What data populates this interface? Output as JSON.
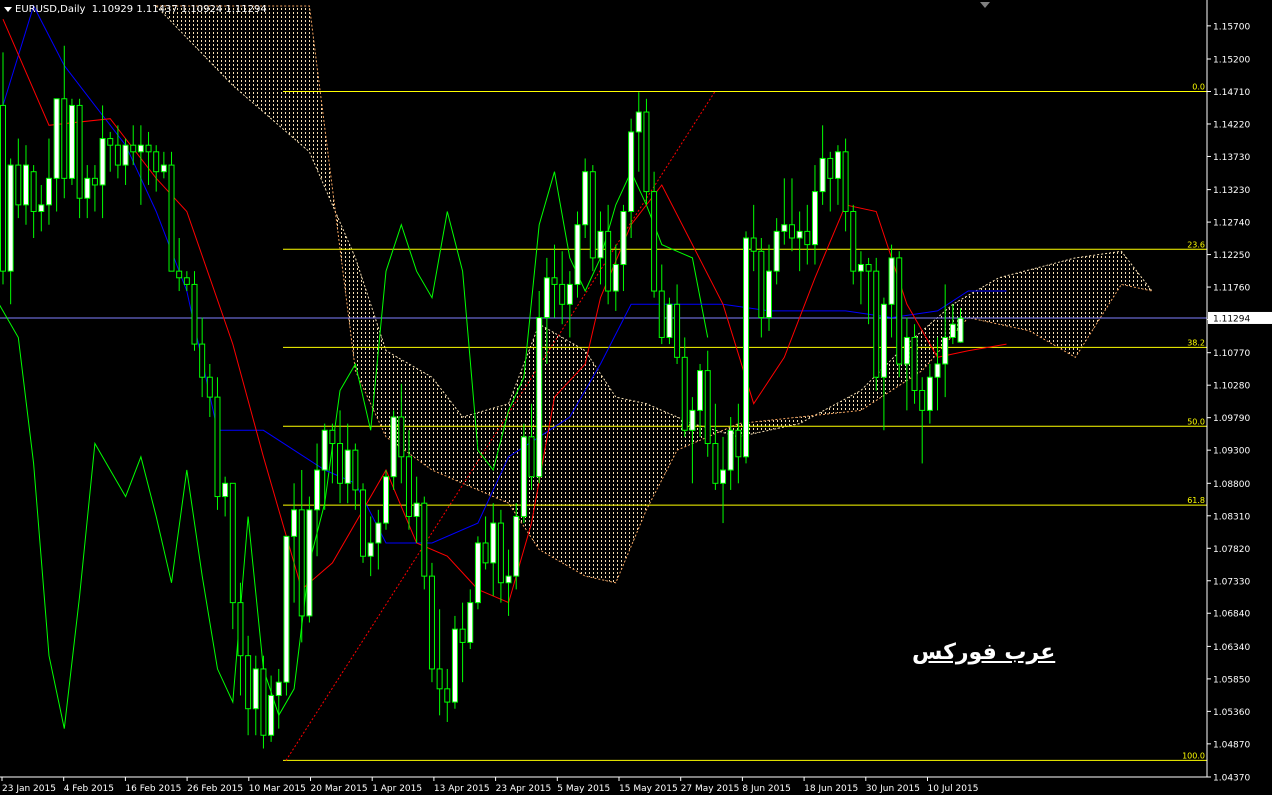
{
  "symbol": {
    "name": "EURUSD,Daily",
    "ohlc": "1.10929 1.11437 1.10924 1.11294"
  },
  "watermark": "عرب فوركس",
  "colors": {
    "background": "#000000",
    "bull": "#00ff00",
    "bear": "#00ff00",
    "bull_body": "#ffffff",
    "tenkan": "#ff0000",
    "kijun": "#0000ff",
    "chikou": "#00ff00",
    "kumo_up": "#f5deb3",
    "kumo_down": "#f4a460",
    "fib": "#ffff00",
    "trend": "#ff0000",
    "price_line": "#7f7fff",
    "axis": "#ffffff"
  },
  "chart_data": {
    "type": "candlestick",
    "title": "EURUSD,Daily",
    "ylim": [
      1.0437,
      1.1609
    ],
    "yticks": [
      "1.15700",
      "1.15200",
      "1.14710",
      "1.14220",
      "1.13730",
      "1.13230",
      "1.12740",
      "1.12250",
      "1.11760",
      "1.11270",
      "1.10770",
      "1.10280",
      "1.09790",
      "1.09300",
      "1.08800",
      "1.08310",
      "1.07820",
      "1.07330",
      "1.06840",
      "1.06340",
      "1.05850",
      "1.05360",
      "1.04870",
      "1.04370"
    ],
    "xticks": [
      "23 Jan 2015",
      "4 Feb 2015",
      "16 Feb 2015",
      "26 Feb 2015",
      "10 Mar 2015",
      "20 Mar 2015",
      "1 Apr 2015",
      "13 Apr 2015",
      "23 Apr 2015",
      "5 May 2015",
      "15 May 2015",
      "27 May 2015",
      "8 Jun 2015",
      "18 Jun 2015",
      "30 Jun 2015",
      "10 Jul 2015"
    ],
    "current_price": "1.11294",
    "fibonacci": [
      {
        "label": "0.0",
        "price": 1.1471
      },
      {
        "label": "23.6",
        "price": 1.1233
      },
      {
        "label": "38.2",
        "price": 1.1085
      },
      {
        "label": "50.0",
        "price": 1.0966
      },
      {
        "label": "61.8",
        "price": 1.0847
      },
      {
        "label": "100.0",
        "price": 1.0462
      }
    ],
    "candles": [
      [
        1.145,
        1.153,
        1.118,
        1.12
      ],
      [
        1.12,
        1.137,
        1.115,
        1.136
      ],
      [
        1.136,
        1.14,
        1.128,
        1.13
      ],
      [
        1.13,
        1.139,
        1.127,
        1.136
      ],
      [
        1.135,
        1.136,
        1.125,
        1.129
      ],
      [
        1.129,
        1.133,
        1.126,
        1.13
      ],
      [
        1.13,
        1.14,
        1.127,
        1.134
      ],
      [
        1.134,
        1.144,
        1.129,
        1.146
      ],
      [
        1.146,
        1.154,
        1.131,
        1.134
      ],
      [
        1.134,
        1.146,
        1.133,
        1.145
      ],
      [
        1.145,
        1.146,
        1.128,
        1.131
      ],
      [
        1.131,
        1.136,
        1.128,
        1.134
      ],
      [
        1.134,
        1.136,
        1.129,
        1.133
      ],
      [
        1.133,
        1.145,
        1.128,
        1.14
      ],
      [
        1.14,
        1.141,
        1.135,
        1.139
      ],
      [
        1.139,
        1.142,
        1.134,
        1.136
      ],
      [
        1.136,
        1.14,
        1.133,
        1.139
      ],
      [
        1.139,
        1.142,
        1.136,
        1.138
      ],
      [
        1.138,
        1.142,
        1.13,
        1.139
      ],
      [
        1.139,
        1.141,
        1.133,
        1.138
      ],
      [
        1.138,
        1.139,
        1.132,
        1.135
      ],
      [
        1.135,
        1.138,
        1.134,
        1.136
      ],
      [
        1.136,
        1.138,
        1.12,
        1.12
      ],
      [
        1.12,
        1.125,
        1.117,
        1.119
      ],
      [
        1.119,
        1.12,
        1.117,
        1.118
      ],
      [
        1.118,
        1.12,
        1.108,
        1.109
      ],
      [
        1.109,
        1.113,
        1.101,
        1.104
      ],
      [
        1.104,
        1.106,
        1.098,
        1.101
      ],
      [
        1.101,
        1.104,
        1.084,
        1.086
      ],
      [
        1.086,
        1.089,
        1.083,
        1.088
      ],
      [
        1.088,
        1.088,
        1.066,
        1.07
      ],
      [
        1.07,
        1.073,
        1.056,
        1.062
      ],
      [
        1.062,
        1.065,
        1.05,
        1.054
      ],
      [
        1.054,
        1.062,
        1.05,
        1.06
      ],
      [
        1.06,
        1.062,
        1.048,
        1.05
      ],
      [
        1.05,
        1.059,
        1.049,
        1.056
      ],
      [
        1.056,
        1.06,
        1.051,
        1.058
      ],
      [
        1.058,
        1.08,
        1.056,
        1.08
      ],
      [
        1.08,
        1.088,
        1.07,
        1.084
      ],
      [
        1.084,
        1.09,
        1.064,
        1.068
      ],
      [
        1.068,
        1.086,
        1.067,
        1.084
      ],
      [
        1.084,
        1.094,
        1.077,
        1.09
      ],
      [
        1.09,
        1.097,
        1.084,
        1.096
      ],
      [
        1.096,
        1.097,
        1.088,
        1.094
      ],
      [
        1.094,
        1.099,
        1.085,
        1.088
      ],
      [
        1.088,
        1.097,
        1.085,
        1.093
      ],
      [
        1.093,
        1.094,
        1.084,
        1.087
      ],
      [
        1.087,
        1.088,
        1.076,
        1.077
      ],
      [
        1.077,
        1.083,
        1.074,
        1.079
      ],
      [
        1.079,
        1.084,
        1.075,
        1.082
      ],
      [
        1.082,
        1.09,
        1.081,
        1.089
      ],
      [
        1.089,
        1.099,
        1.087,
        1.098
      ],
      [
        1.098,
        1.103,
        1.088,
        1.092
      ],
      [
        1.092,
        1.096,
        1.081,
        1.083
      ],
      [
        1.083,
        1.089,
        1.079,
        1.085
      ],
      [
        1.085,
        1.086,
        1.072,
        1.074
      ],
      [
        1.074,
        1.076,
        1.058,
        1.06
      ],
      [
        1.06,
        1.069,
        1.053,
        1.057
      ],
      [
        1.057,
        1.06,
        1.052,
        1.055
      ],
      [
        1.055,
        1.068,
        1.054,
        1.066
      ],
      [
        1.066,
        1.07,
        1.058,
        1.064
      ],
      [
        1.064,
        1.072,
        1.063,
        1.07
      ],
      [
        1.07,
        1.08,
        1.069,
        1.079
      ],
      [
        1.079,
        1.083,
        1.075,
        1.076
      ],
      [
        1.076,
        1.085,
        1.071,
        1.082
      ],
      [
        1.082,
        1.084,
        1.07,
        1.073
      ],
      [
        1.073,
        1.078,
        1.068,
        1.074
      ],
      [
        1.074,
        1.085,
        1.072,
        1.083
      ],
      [
        1.083,
        1.097,
        1.082,
        1.095
      ],
      [
        1.095,
        1.1,
        1.087,
        1.089
      ],
      [
        1.089,
        1.117,
        1.088,
        1.113
      ],
      [
        1.113,
        1.122,
        1.106,
        1.119
      ],
      [
        1.119,
        1.124,
        1.113,
        1.118
      ],
      [
        1.118,
        1.123,
        1.112,
        1.115
      ],
      [
        1.115,
        1.12,
        1.11,
        1.118
      ],
      [
        1.118,
        1.129,
        1.116,
        1.127
      ],
      [
        1.127,
        1.137,
        1.125,
        1.135
      ],
      [
        1.135,
        1.136,
        1.12,
        1.122
      ],
      [
        1.122,
        1.129,
        1.118,
        1.126
      ],
      [
        1.126,
        1.13,
        1.115,
        1.117
      ],
      [
        1.117,
        1.124,
        1.114,
        1.121
      ],
      [
        1.121,
        1.13,
        1.117,
        1.129
      ],
      [
        1.129,
        1.143,
        1.125,
        1.141
      ],
      [
        1.141,
        1.147,
        1.135,
        1.144
      ],
      [
        1.144,
        1.146,
        1.13,
        1.132
      ],
      [
        1.132,
        1.135,
        1.116,
        1.117
      ],
      [
        1.117,
        1.121,
        1.109,
        1.11
      ],
      [
        1.11,
        1.116,
        1.109,
        1.115
      ],
      [
        1.115,
        1.118,
        1.106,
        1.107
      ],
      [
        1.107,
        1.11,
        1.095,
        1.096
      ],
      [
        1.096,
        1.101,
        1.088,
        1.099
      ],
      [
        1.099,
        1.106,
        1.095,
        1.105
      ],
      [
        1.105,
        1.108,
        1.092,
        1.094
      ],
      [
        1.094,
        1.1,
        1.087,
        1.088
      ],
      [
        1.088,
        1.095,
        1.082,
        1.09
      ],
      [
        1.09,
        1.098,
        1.087,
        1.096
      ],
      [
        1.096,
        1.1,
        1.088,
        1.092
      ],
      [
        1.092,
        1.126,
        1.091,
        1.125
      ],
      [
        1.125,
        1.13,
        1.12,
        1.123
      ],
      [
        1.123,
        1.125,
        1.11,
        1.113
      ],
      [
        1.113,
        1.124,
        1.111,
        1.12
      ],
      [
        1.12,
        1.128,
        1.118,
        1.126
      ],
      [
        1.126,
        1.134,
        1.124,
        1.127
      ],
      [
        1.127,
        1.134,
        1.123,
        1.125
      ],
      [
        1.125,
        1.129,
        1.12,
        1.126
      ],
      [
        1.126,
        1.13,
        1.121,
        1.124
      ],
      [
        1.124,
        1.136,
        1.121,
        1.132
      ],
      [
        1.132,
        1.142,
        1.13,
        1.137
      ],
      [
        1.137,
        1.138,
        1.129,
        1.134
      ],
      [
        1.134,
        1.139,
        1.13,
        1.138
      ],
      [
        1.138,
        1.14,
        1.126,
        1.129
      ],
      [
        1.129,
        1.13,
        1.118,
        1.12
      ],
      [
        1.12,
        1.123,
        1.115,
        1.121
      ],
      [
        1.121,
        1.122,
        1.112,
        1.12
      ],
      [
        1.12,
        1.122,
        1.102,
        1.104
      ],
      [
        1.104,
        1.116,
        1.096,
        1.115
      ],
      [
        1.115,
        1.124,
        1.11,
        1.122
      ],
      [
        1.122,
        1.123,
        1.104,
        1.106
      ],
      [
        1.106,
        1.113,
        1.099,
        1.11
      ],
      [
        1.11,
        1.112,
        1.1,
        1.102
      ],
      [
        1.102,
        1.104,
        1.091,
        1.099
      ],
      [
        1.099,
        1.106,
        1.097,
        1.104
      ],
      [
        1.104,
        1.11,
        1.099,
        1.106
      ],
      [
        1.106,
        1.118,
        1.101,
        1.11
      ],
      [
        1.11,
        1.115,
        1.109,
        1.112
      ],
      [
        1.1093,
        1.1144,
        1.1092,
        1.1129
      ]
    ],
    "tenkan": [
      [
        0,
        1.158
      ],
      [
        6,
        1.142
      ],
      [
        14,
        1.143
      ],
      [
        20,
        1.134
      ],
      [
        24,
        1.129
      ],
      [
        30,
        1.109
      ],
      [
        34,
        1.092
      ],
      [
        39,
        1.072
      ],
      [
        43,
        1.076
      ],
      [
        48,
        1.086
      ],
      [
        50,
        1.09
      ],
      [
        54,
        1.079
      ],
      [
        58,
        1.077
      ],
      [
        62,
        1.072
      ],
      [
        66,
        1.07
      ],
      [
        69,
        1.082
      ],
      [
        72,
        1.101
      ],
      [
        76,
        1.106
      ],
      [
        78,
        1.116
      ],
      [
        82,
        1.127
      ],
      [
        86,
        1.133
      ],
      [
        90,
        1.124
      ],
      [
        94,
        1.115
      ],
      [
        98,
        1.1
      ],
      [
        102,
        1.107
      ],
      [
        106,
        1.119
      ],
      [
        110,
        1.13
      ],
      [
        114,
        1.129
      ],
      [
        118,
        1.115
      ],
      [
        122,
        1.107
      ],
      [
        126,
        1.108
      ],
      [
        131,
        1.109
      ]
    ],
    "kijun": [
      [
        0,
        1.145
      ],
      [
        4,
        1.16
      ],
      [
        8,
        1.151
      ],
      [
        12,
        1.145
      ],
      [
        16,
        1.139
      ],
      [
        20,
        1.129
      ],
      [
        24,
        1.117
      ],
      [
        28,
        1.096
      ],
      [
        34,
        1.096
      ],
      [
        38,
        1.093
      ],
      [
        42,
        1.09
      ],
      [
        46,
        1.088
      ],
      [
        50,
        1.079
      ],
      [
        56,
        1.079
      ],
      [
        62,
        1.082
      ],
      [
        66,
        1.092
      ],
      [
        70,
        1.095
      ],
      [
        74,
        1.098
      ],
      [
        78,
        1.106
      ],
      [
        82,
        1.115
      ],
      [
        86,
        1.115
      ],
      [
        94,
        1.115
      ],
      [
        100,
        1.114
      ],
      [
        110,
        1.114
      ],
      [
        116,
        1.113
      ],
      [
        122,
        1.114
      ],
      [
        126,
        1.117
      ],
      [
        131,
        1.117
      ]
    ],
    "chikou": [
      [
        -2,
        1.118
      ],
      [
        2,
        1.11
      ],
      [
        4,
        1.091
      ],
      [
        6,
        1.062
      ],
      [
        8,
        1.051
      ],
      [
        10,
        1.071
      ],
      [
        12,
        1.094
      ],
      [
        14,
        1.09
      ],
      [
        16,
        1.086
      ],
      [
        18,
        1.092
      ],
      [
        20,
        1.083
      ],
      [
        22,
        1.073
      ],
      [
        24,
        1.09
      ],
      [
        26,
        1.074
      ],
      [
        28,
        1.06
      ],
      [
        30,
        1.055
      ],
      [
        32,
        1.083
      ],
      [
        34,
        1.06
      ],
      [
        36,
        1.053
      ],
      [
        38,
        1.057
      ],
      [
        40,
        1.076
      ],
      [
        42,
        1.085
      ],
      [
        44,
        1.102
      ],
      [
        46,
        1.106
      ],
      [
        48,
        1.096
      ],
      [
        50,
        1.12
      ],
      [
        52,
        1.127
      ],
      [
        54,
        1.12
      ],
      [
        56,
        1.116
      ],
      [
        58,
        1.129
      ],
      [
        60,
        1.12
      ],
      [
        62,
        1.093
      ],
      [
        64,
        1.09
      ],
      [
        66,
        1.099
      ],
      [
        68,
        1.104
      ],
      [
        70,
        1.127
      ],
      [
        72,
        1.135
      ],
      [
        74,
        1.122
      ],
      [
        76,
        1.117
      ],
      [
        78,
        1.122
      ],
      [
        80,
        1.13
      ],
      [
        82,
        1.135
      ],
      [
        84,
        1.13
      ],
      [
        86,
        1.124
      ],
      [
        88,
        1.123
      ],
      [
        90,
        1.122
      ],
      [
        92,
        1.11
      ]
    ],
    "kumo_a": [
      [
        20,
        1.16
      ],
      [
        30,
        1.148
      ],
      [
        40,
        1.138
      ],
      [
        46,
        1.122
      ],
      [
        50,
        1.108
      ],
      [
        56,
        1.104
      ],
      [
        60,
        1.098
      ],
      [
        66,
        1.1
      ],
      [
        70,
        1.112
      ],
      [
        76,
        1.108
      ],
      [
        80,
        1.101
      ],
      [
        84,
        1.1
      ],
      [
        90,
        1.097
      ],
      [
        96,
        1.095
      ],
      [
        104,
        1.097
      ],
      [
        112,
        1.102
      ],
      [
        118,
        1.109
      ],
      [
        124,
        1.115
      ],
      [
        130,
        1.119
      ],
      [
        140,
        1.122
      ],
      [
        146,
        1.123
      ],
      [
        150,
        1.117
      ]
    ],
    "kumo_b": [
      [
        20,
        1.16
      ],
      [
        30,
        1.16
      ],
      [
        40,
        1.16
      ],
      [
        46,
        1.105
      ],
      [
        50,
        1.095
      ],
      [
        56,
        1.09
      ],
      [
        60,
        1.088
      ],
      [
        66,
        1.085
      ],
      [
        70,
        1.078
      ],
      [
        76,
        1.074
      ],
      [
        80,
        1.073
      ],
      [
        84,
        1.084
      ],
      [
        88,
        1.093
      ],
      [
        96,
        1.097
      ],
      [
        104,
        1.098
      ],
      [
        112,
        1.099
      ],
      [
        120,
        1.105
      ],
      [
        126,
        1.113
      ],
      [
        134,
        1.111
      ],
      [
        140,
        1.107
      ],
      [
        146,
        1.118
      ],
      [
        150,
        1.117
      ]
    ]
  }
}
